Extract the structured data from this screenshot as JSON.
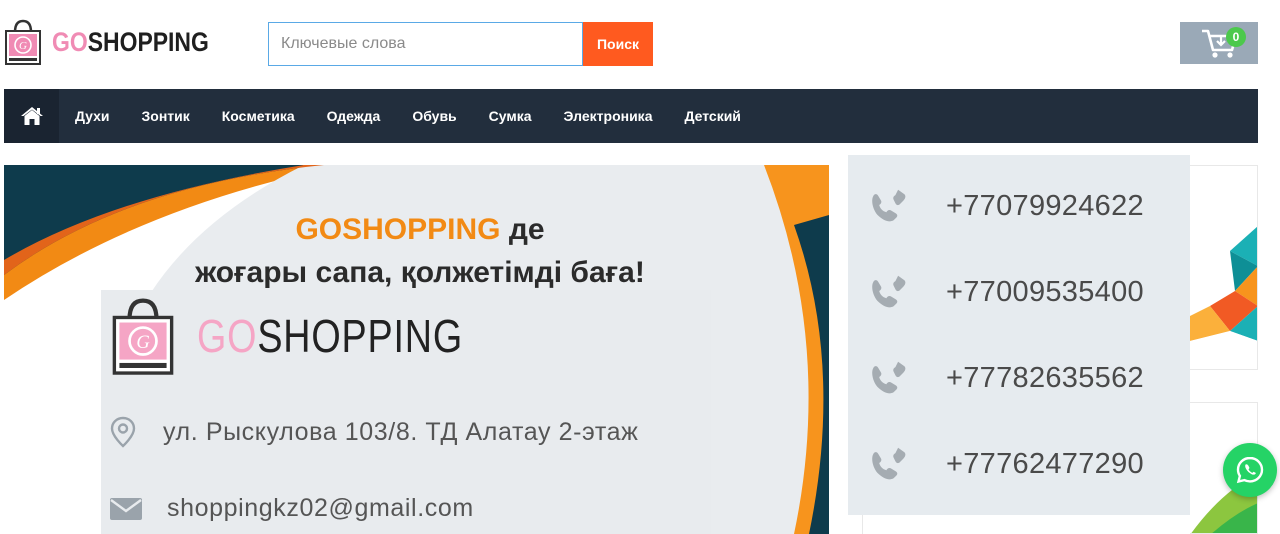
{
  "header": {
    "logo": {
      "go": "GO",
      "shop": "SHOPPING"
    },
    "search": {
      "placeholder": "Ключевые слова",
      "value": "",
      "button_label": "Поиск"
    },
    "cart": {
      "count": "0"
    }
  },
  "nav": {
    "items": [
      {
        "label": "Духи"
      },
      {
        "label": "Зонтик"
      },
      {
        "label": "Косметика"
      },
      {
        "label": "Одежда"
      },
      {
        "label": "Обувь"
      },
      {
        "label": "Сумка"
      },
      {
        "label": "Электроника"
      },
      {
        "label": "Детский"
      }
    ]
  },
  "banner": {
    "title_brand": "GOSHOPPING",
    "title_rest": " де",
    "title_line2": "жоғары сапа, қолжетімді баға!",
    "card_logo": {
      "go": "GO",
      "shop": "SHOPPING"
    },
    "address": "ул. Рыскулова 103/8. ТД Алатау 2-этаж",
    "email": "shoppingkz02@gmail.com"
  },
  "phones": [
    {
      "number": "+77079924622"
    },
    {
      "number": "+77009535400"
    },
    {
      "number": "+77782635562"
    },
    {
      "number": "+77762477290"
    }
  ],
  "colors": {
    "nav_bg": "#222e3d",
    "search_button": "#ff5a1f",
    "brand_orange": "#f28a14",
    "brand_pink": "#f08bb4",
    "whatsapp": "#25d366",
    "cart_badge": "#4cc94c"
  },
  "icons": [
    "home-icon",
    "cart-icon",
    "location-icon",
    "mail-icon",
    "phone-icon",
    "whatsapp-icon",
    "shopping-bag-logo-icon"
  ]
}
